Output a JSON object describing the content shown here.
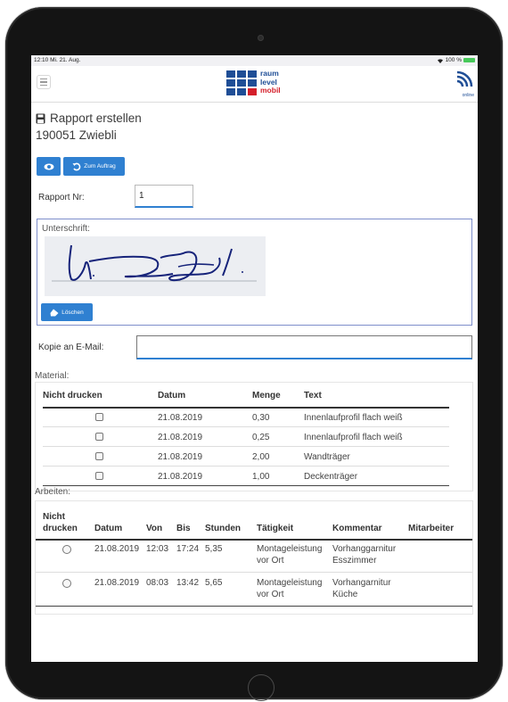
{
  "status": {
    "time": "12:10",
    "date": "Mi. 21. Aug.",
    "battery": "100 %"
  },
  "logo": {
    "line1": "raum",
    "line2": "level",
    "line3": "mobil"
  },
  "online": {
    "label": "online"
  },
  "page": {
    "title": "Rapport erstellen",
    "subtitle": "190051 Zwiebli"
  },
  "buttons": {
    "auftrag_label": "Zum Auftrag",
    "loeschen_label": "Löschen"
  },
  "form": {
    "rapport_nr_label": "Rapport Nr:",
    "rapport_nr_value": "1",
    "signature_label": "Unterschrift:",
    "email_label": "Kopie an E-Mail:",
    "email_value": ""
  },
  "material": {
    "section_label": "Material:",
    "headers": [
      "Nicht drucken",
      "Datum",
      "Menge",
      "Text"
    ],
    "rows": [
      {
        "datum": "21.08.2019",
        "menge": "0,30",
        "text": "Innenlaufprofil flach weiß"
      },
      {
        "datum": "21.08.2019",
        "menge": "0,25",
        "text": "Innenlaufprofil flach weiß"
      },
      {
        "datum": "21.08.2019",
        "menge": "2,00",
        "text": "Wandträger"
      },
      {
        "datum": "21.08.2019",
        "menge": "1,00",
        "text": "Deckenträger"
      }
    ]
  },
  "arbeiten": {
    "section_label": "Arbeiten:",
    "headers": {
      "nicht": "Nicht",
      "drucken": "drucken",
      "datum": "Datum",
      "von": "Von",
      "bis": "Bis",
      "stunden": "Stunden",
      "taetigkeit": "Tätigkeit",
      "kommentar": "Kommentar",
      "mitarbeiter": "Mitarbeiter"
    },
    "rows": [
      {
        "datum": "21.08.2019",
        "von": "12:03",
        "bis": "17:24",
        "stunden": "5,35",
        "taetigkeit_1": "Montageleistung",
        "taetigkeit_2": "vor Ort",
        "kommentar_1": "Vorhanggarnitur",
        "kommentar_2": "Esszimmer"
      },
      {
        "datum": "21.08.2019",
        "von": "08:03",
        "bis": "13:42",
        "stunden": "5,65",
        "taetigkeit_1": "Montageleistung",
        "taetigkeit_2": "vor Ort",
        "kommentar_1": "Vorhangarnitur",
        "kommentar_2": "Küche"
      }
    ]
  },
  "colors": {
    "primary": "#2f80d1",
    "logo_blue": "#1f4e96",
    "logo_red": "#d41f2a"
  }
}
